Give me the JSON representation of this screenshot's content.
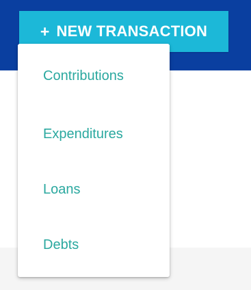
{
  "button": {
    "plus": "+",
    "label": "NEW TRANSACTION"
  },
  "menu": {
    "items": [
      {
        "label": "Contributions"
      },
      {
        "label": "Expenditures"
      },
      {
        "label": "Loans"
      },
      {
        "label": "Debts"
      }
    ]
  },
  "colors": {
    "header_background": "#0a3fa0",
    "button_background": "#1cb8d8",
    "menu_text": "#2aa89f",
    "lower_background": "#f5f5f5"
  },
  "icons": {
    "button_icon": "plus-icon"
  }
}
